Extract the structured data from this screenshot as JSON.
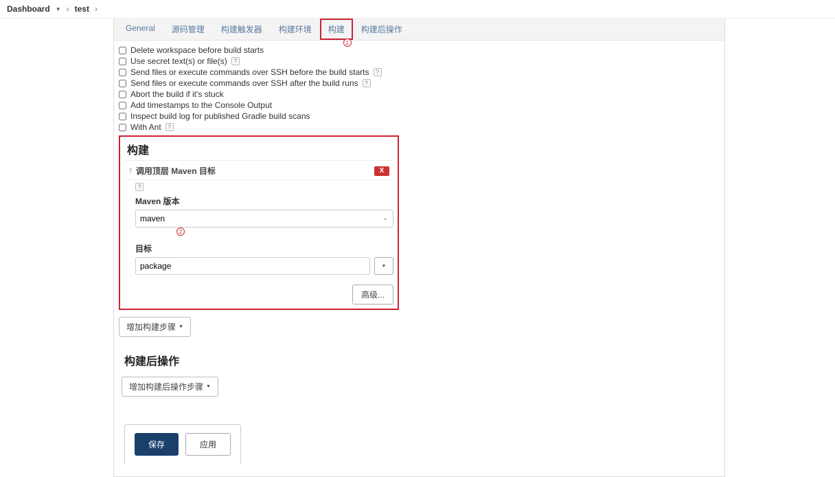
{
  "breadcrumb": {
    "root": "Dashboard",
    "item": "test"
  },
  "tabs": {
    "general": "General",
    "scm": "源码管理",
    "triggers": "构建触发器",
    "env": "构建环境",
    "build": "构建",
    "post": "构建后操作"
  },
  "annotations": {
    "badge1": "1",
    "badge2": "2"
  },
  "env_checks": {
    "del_ws": "Delete workspace before build starts",
    "secret": "Use secret text(s) or file(s)",
    "ssh_before": "Send files or execute commands over SSH before the build starts",
    "ssh_after": "Send files or execute commands over SSH after the build runs",
    "abort": "Abort the build if it's stuck",
    "timestamps": "Add timestamps to the Console Output",
    "gradle": "Inspect build log for published Gradle build scans",
    "ant": "With Ant"
  },
  "build": {
    "title": "构建",
    "step_title": "调用顶层 Maven 目标",
    "maven_version_label": "Maven 版本",
    "maven_selected": "maven",
    "targets_label": "目标",
    "targets_value": "package",
    "advanced": "高级...",
    "delete": "X",
    "add_step": "增加构建步骤"
  },
  "post": {
    "title": "构建后操作",
    "add_step": "增加构建后操作步骤"
  },
  "bottom": {
    "save": "保存",
    "apply": "应用"
  }
}
